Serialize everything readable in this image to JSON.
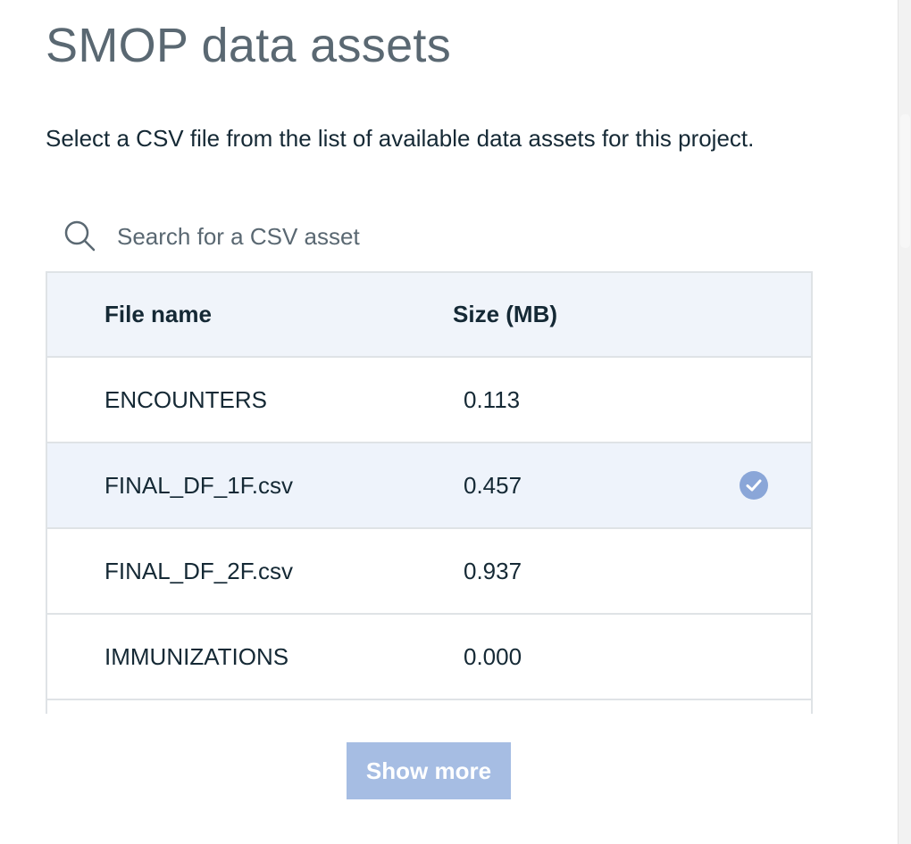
{
  "page": {
    "title": "SMOP data assets",
    "description": "Select a CSV file from the list of available data assets for this project."
  },
  "search": {
    "placeholder": "Search for a CSV asset",
    "value": "",
    "icon": "search-icon"
  },
  "table": {
    "columns": [
      "File name",
      "Size (MB)"
    ],
    "rows": [
      {
        "name": "ENCOUNTERS",
        "size": "0.113",
        "selected": false
      },
      {
        "name": "FINAL_DF_1F.csv",
        "size": "0.457",
        "selected": true
      },
      {
        "name": "FINAL_DF_2F.csv",
        "size": "0.937",
        "selected": false
      },
      {
        "name": "IMMUNIZATIONS",
        "size": "0.000",
        "selected": false
      },
      {
        "name": "",
        "size": "",
        "selected": false
      }
    ]
  },
  "actions": {
    "show_more_label": "Show more"
  },
  "colors": {
    "selected_row": "#eef3fb",
    "header_bg": "#f0f4fa",
    "check_icon": "#8aa6d8",
    "show_more_bg": "#a6bde3"
  }
}
